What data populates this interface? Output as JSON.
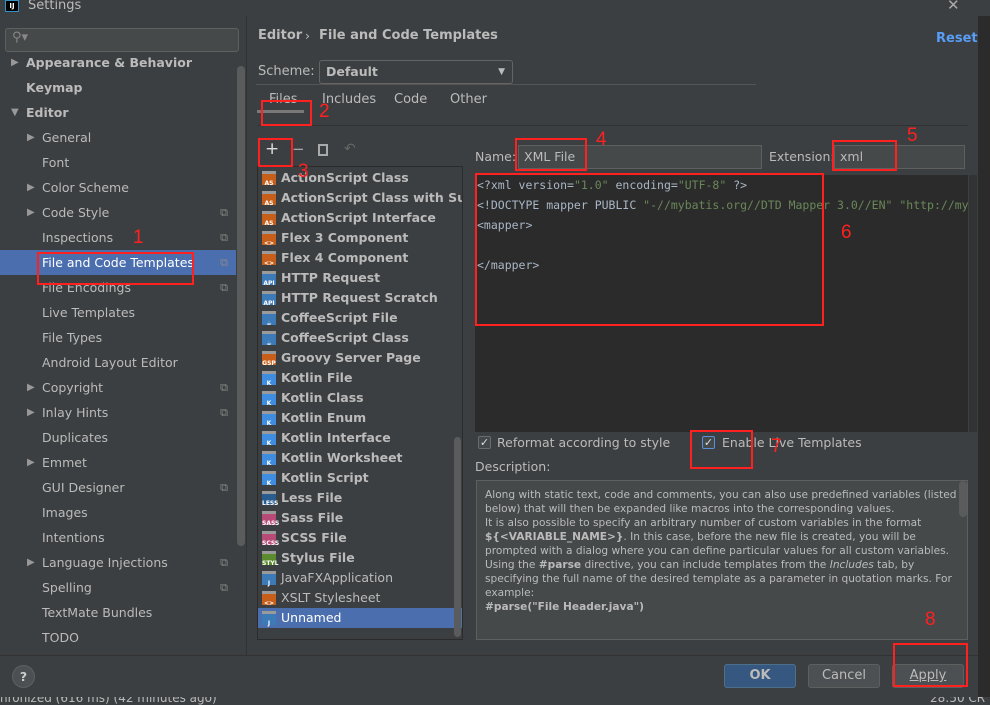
{
  "window": {
    "title": "Settings",
    "close_icon": "close-icon"
  },
  "sidebar": {
    "search_placeholder": "",
    "items": [
      {
        "label": "Appearance & Behavior",
        "level": 0,
        "bold": true,
        "arrow": "right"
      },
      {
        "label": "Keymap",
        "level": 0,
        "bold": true
      },
      {
        "label": "Editor",
        "level": 0,
        "bold": true,
        "arrow": "down"
      },
      {
        "label": "General",
        "level": 1,
        "arrow": "right"
      },
      {
        "label": "Font",
        "level": 1
      },
      {
        "label": "Color Scheme",
        "level": 1,
        "arrow": "right"
      },
      {
        "label": "Code Style",
        "level": 1,
        "arrow": "right",
        "copy": true
      },
      {
        "label": "Inspections",
        "level": 1,
        "copy": true
      },
      {
        "label": "File and Code Templates",
        "level": 1,
        "copy": true,
        "selected": true
      },
      {
        "label": "File Encodings",
        "level": 1,
        "copy": true
      },
      {
        "label": "Live Templates",
        "level": 1
      },
      {
        "label": "File Types",
        "level": 1
      },
      {
        "label": "Android Layout Editor",
        "level": 1
      },
      {
        "label": "Copyright",
        "level": 1,
        "arrow": "right",
        "copy": true
      },
      {
        "label": "Inlay Hints",
        "level": 1,
        "arrow": "right",
        "copy": true
      },
      {
        "label": "Duplicates",
        "level": 1
      },
      {
        "label": "Emmet",
        "level": 1,
        "arrow": "right"
      },
      {
        "label": "GUI Designer",
        "level": 1,
        "copy": true
      },
      {
        "label": "Images",
        "level": 1
      },
      {
        "label": "Intentions",
        "level": 1
      },
      {
        "label": "Language Injections",
        "level": 1,
        "arrow": "right",
        "copy": true
      },
      {
        "label": "Spelling",
        "level": 1,
        "copy": true
      },
      {
        "label": "TextMate Bundles",
        "level": 1
      },
      {
        "label": "TODO",
        "level": 1
      }
    ]
  },
  "header": {
    "breadcrumb_parent": "Editor",
    "breadcrumb_sep": "›",
    "breadcrumb_current": "File and Code Templates",
    "reset": "Reset"
  },
  "scheme": {
    "label": "Scheme:",
    "value": "Default"
  },
  "tabs": [
    {
      "label": "Files",
      "active": true
    },
    {
      "label": "Includes"
    },
    {
      "label": "Code"
    },
    {
      "label": "Other"
    }
  ],
  "toolbar": {
    "add": "+",
    "remove": "−",
    "copy_icon": "copy-icon",
    "reset_icon": "undo-icon"
  },
  "files": [
    {
      "label": "ActionScript Class",
      "badge": "AS",
      "color": "#c75f1b",
      "bold": true
    },
    {
      "label": "ActionScript Class with Supers",
      "badge": "AS",
      "color": "#c75f1b",
      "bold": true
    },
    {
      "label": "ActionScript Interface",
      "badge": "AS",
      "color": "#c75f1b",
      "bold": true
    },
    {
      "label": "Flex 3 Component",
      "badge": "<>",
      "color": "#c75f1b",
      "bold": true
    },
    {
      "label": "Flex 4 Component",
      "badge": "<>",
      "color": "#c75f1b",
      "bold": true
    },
    {
      "label": "HTTP Request",
      "badge": "API",
      "color": "#3d7ab8",
      "bold": true
    },
    {
      "label": "HTTP Request Scratch",
      "badge": "API",
      "color": "#3d7ab8",
      "bold": true
    },
    {
      "label": "CoffeeScript File",
      "badge": "☕",
      "color": "#3d7ab8",
      "bold": true
    },
    {
      "label": "CoffeeScript Class",
      "badge": "☕",
      "color": "#3d7ab8",
      "bold": true
    },
    {
      "label": "Groovy Server Page",
      "badge": "GSP",
      "color": "#c75f1b",
      "bold": true
    },
    {
      "label": "Kotlin File",
      "badge": "K",
      "color": "#3f8de0",
      "bold": true
    },
    {
      "label": "Kotlin Class",
      "badge": "K",
      "color": "#3f8de0",
      "bold": true
    },
    {
      "label": "Kotlin Enum",
      "badge": "K",
      "color": "#3f8de0",
      "bold": true
    },
    {
      "label": "Kotlin Interface",
      "badge": "K",
      "color": "#3f8de0",
      "bold": true
    },
    {
      "label": "Kotlin Worksheet",
      "badge": "K",
      "color": "#3f8de0",
      "bold": true
    },
    {
      "label": "Kotlin Script",
      "badge": "K",
      "color": "#3f8de0",
      "bold": true
    },
    {
      "label": "Less File",
      "badge": "LESS",
      "color": "#2a5d8f",
      "bold": true
    },
    {
      "label": "Sass File",
      "badge": "SASS",
      "color": "#b74a76",
      "bold": true
    },
    {
      "label": "SCSS File",
      "badge": "SCSS",
      "color": "#b74a76",
      "bold": true
    },
    {
      "label": "Stylus File",
      "badge": "STYL",
      "color": "#5c8a2e",
      "bold": true
    },
    {
      "label": "JavaFXApplication",
      "badge": "J",
      "color": "#3d7ab8",
      "bold": false
    },
    {
      "label": "XSLT Stylesheet",
      "badge": "<>",
      "color": "#c75f1b",
      "bold": false
    },
    {
      "label": "Unnamed",
      "badge": "J",
      "color": "#3d7ab8",
      "bold": false,
      "selected": true
    }
  ],
  "editor": {
    "name_label": "Name:",
    "name_value": "XML File",
    "ext_label": "Extension:",
    "ext_value": "xml",
    "code": {
      "l1a": "<?xml version=",
      "l1b": "\"1.0\"",
      "l1c": " encoding=",
      "l1d": "\"UTF-8\"",
      "l1e": " ?>",
      "l2a": "<!DOCTYPE mapper PUBLIC ",
      "l2b": "\"-//mybatis.org//DTD Mapper 3.0//EN\"",
      "l2c": " ",
      "l2d": "\"http://my",
      "l3": "<mapper>",
      "l5": "</mapper>"
    },
    "reformat_label": "Reformat according to style",
    "reformat_checked": true,
    "live_label": "Enable Live Templates",
    "live_checked": true,
    "description_label": "Description:"
  },
  "description": {
    "p1": "Along with static text, code and comments, you can also use predefined variables (listed below) that will then be expanded like macros into the corresponding values.",
    "p2a": "It is also possible to specify an arbitrary number of custom variables in the format ",
    "p2b": "${<VARIABLE_NAME>}",
    "p2c": ". In this case, before the new file is created, you will be prompted with a dialog where you can define particular values for all custom variables.",
    "p3a": "Using the ",
    "p3b": "#parse",
    "p3c": " directive, you can include templates from the ",
    "p3d": "Includes",
    "p3e": " tab, by specifying the full name of the desired template as a parameter in quotation marks. For example:",
    "p4": "#parse(\"File Header.java\")"
  },
  "buttons": {
    "help": "?",
    "ok": "OK",
    "cancel": "Cancel",
    "apply": "Apply"
  },
  "status": {
    "left": "nronized (616 ms) (42 minutes ago)",
    "right": "28:50  CR"
  },
  "annotations": [
    "1",
    "2",
    "3",
    "4",
    "5",
    "6",
    "7",
    "8"
  ],
  "colors": {
    "accent": "#4b6eaf",
    "annotation": "#ff2020",
    "link": "#589df6"
  }
}
